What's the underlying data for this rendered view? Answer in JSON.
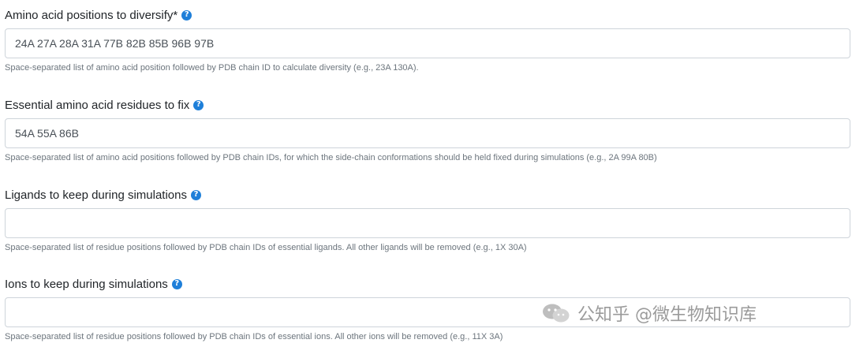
{
  "fields": [
    {
      "label": "Amino acid positions to diversify*",
      "help_icon": "?",
      "value": "24A 27A 28A 31A 77B 82B 85B 96B 97B",
      "help_text": "Space-separated list of amino acid position followed by PDB chain ID to calculate diversity (e.g., 23A 130A)."
    },
    {
      "label": "Essential amino acid residues to fix",
      "help_icon": "?",
      "value": "54A 55A 86B",
      "help_text": "Space-separated list of amino acid positions followed by PDB chain IDs, for which the side-chain conformations should be held fixed during simulations (e.g., 2A 99A 80B)"
    },
    {
      "label": "Ligands to keep during simulations",
      "help_icon": "?",
      "value": "",
      "help_text": "Space-separated list of residue positions followed by PDB chain IDs of essential ligands. All other ligands will be removed (e.g., 1X 30A)"
    },
    {
      "label": "Ions to keep during simulations",
      "help_icon": "?",
      "value": "",
      "help_text": "Space-separated list of residue positions followed by PDB chain IDs of essential ions. All other ions will be removed (e.g., 11X 3A)"
    }
  ],
  "watermark": {
    "text": "公知乎 @微生物知识库",
    "icon": "wechat-logo-icon"
  },
  "colors": {
    "help_icon": "#1e7fd9",
    "input_border": "#ced4da",
    "help_text": "#6c757d"
  }
}
